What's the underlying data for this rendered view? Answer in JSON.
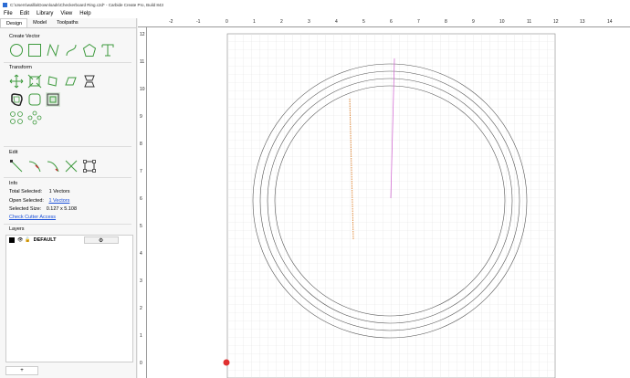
{
  "window": {
    "title": "C:\\Users\\wallla\\Downloads\\Checkerboard Ring.c2d* - Carbide Create Pro, Build 843"
  },
  "menu": [
    "File",
    "Edit",
    "Library",
    "View",
    "Help"
  ],
  "tabs": [
    "Design",
    "Model",
    "Toolpaths"
  ],
  "sections": {
    "create_vector": "Create Vector",
    "transform": "Transform",
    "edit": "Edit",
    "info": "Info",
    "layers": "Layers"
  },
  "info": {
    "total_selected_label": "Total Selected:",
    "total_selected_value": "1 Vectors",
    "open_selected_label": "Open Selected:",
    "open_selected_value": "1 Vectors",
    "selected_size_label": "Selected Size:",
    "selected_size_value": "0.127 x 5.108",
    "check_cutter": "Check Cutter Access"
  },
  "layers": [
    {
      "name": "DEFAULT",
      "color": "#000000"
    }
  ],
  "add_layer_label": "+",
  "gear_glyph": "⚙",
  "eye_glyph": "👁",
  "lock_glyph": "🔓",
  "ruler_x": [
    "-2",
    "-1",
    "0",
    "1",
    "2",
    "3",
    "4",
    "5",
    "6",
    "7",
    "8",
    "9",
    "10",
    "11",
    "12",
    "13",
    "14"
  ],
  "ruler_y": [
    "12",
    "11",
    "10",
    "9",
    "8",
    "7",
    "6",
    "5",
    "4",
    "3",
    "2",
    "1",
    "0"
  ],
  "colors": {
    "accent_green": "#3d9a3d",
    "orange_path": "#e08a3c",
    "magenta_path": "#d36fd3",
    "link": "#1a4fd8"
  }
}
